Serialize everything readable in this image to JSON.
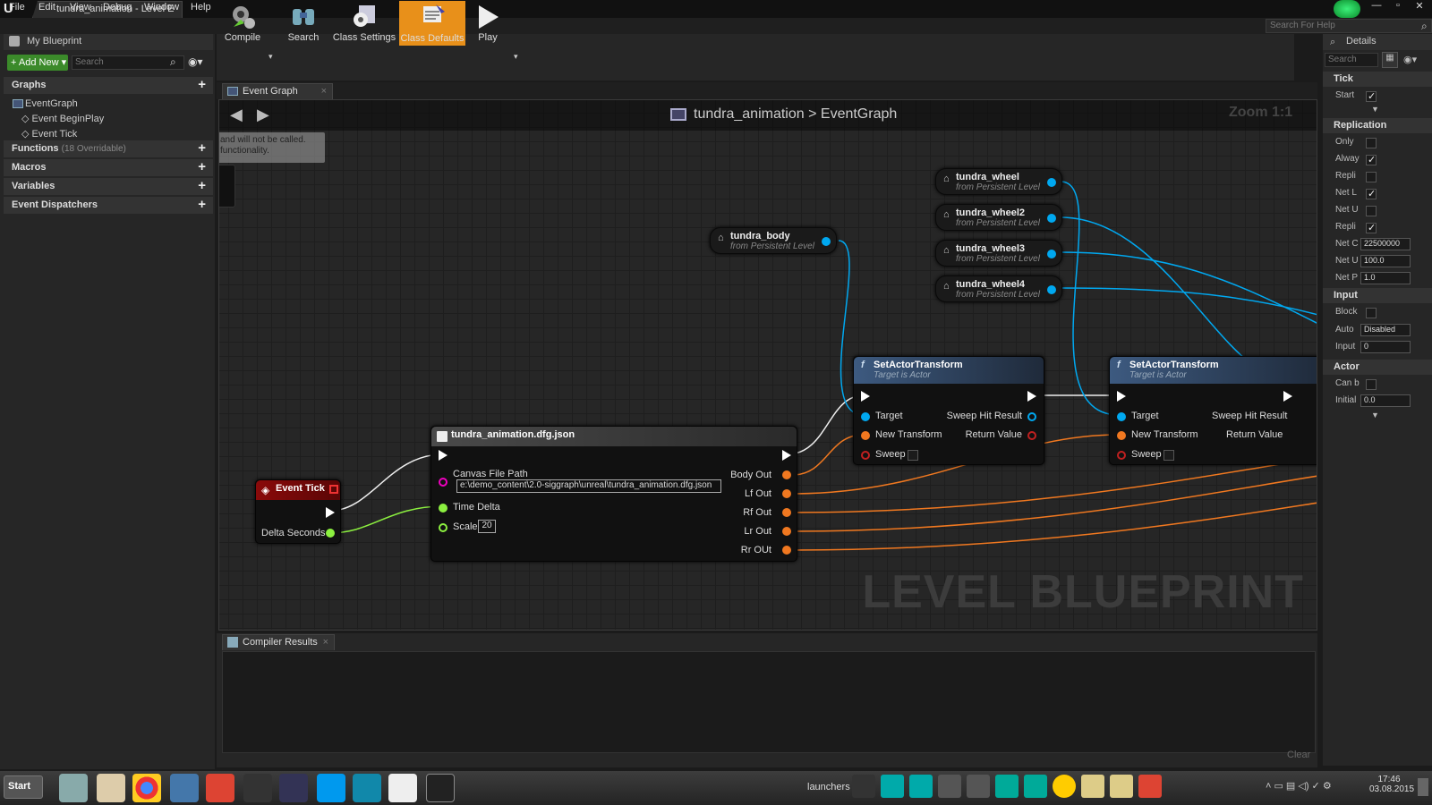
{
  "window": {
    "tab_title": "tundra_animation - Level E",
    "help_search_placeholder": "Search For Help"
  },
  "menu": [
    "File",
    "Edit",
    "View",
    "Debug",
    "Window",
    "Help"
  ],
  "my_blueprint": {
    "title": "My Blueprint",
    "add_new": "Add New",
    "search_placeholder": "Search",
    "graphs_label": "Graphs",
    "graph_items": [
      "EventGraph",
      "Event BeginPlay",
      "Event Tick"
    ],
    "functions_label": "Functions",
    "functions_note": "(18 Overridable)",
    "macros_label": "Macros",
    "variables_label": "Variables",
    "dispatchers_label": "Event Dispatchers"
  },
  "toolbar": {
    "compile": "Compile",
    "search": "Search",
    "class_settings": "Class Settings",
    "class_defaults": "Class Defaults",
    "play": "Play"
  },
  "graph_tab": "Event Graph",
  "breadcrumb": {
    "blueprint": "tundra_animation",
    "separator": ">",
    "graph": "EventGraph"
  },
  "zoom": "Zoom 1:1",
  "comment_lines": [
    "and will not be called.",
    "functionality."
  ],
  "nodes": {
    "event_tick": {
      "title": "Event Tick",
      "pin": "Delta Seconds"
    },
    "dfg": {
      "title": "tundra_animation.dfg.json",
      "in_pins": [
        "Canvas File Path",
        "Time Delta",
        "Scale"
      ],
      "path_value": "e:\\demo_content\\2.0-siggraph\\unreal\\tundra_animation.dfg.json",
      "scale_value": "20",
      "out_pins": [
        "Body Out",
        "Lf Out",
        "Rf Out",
        "Lr Out",
        "Rr OUt"
      ]
    },
    "getters": [
      {
        "name": "tundra_body",
        "sub": "from Persistent Level"
      },
      {
        "name": "tundra_wheel",
        "sub": "from Persistent Level"
      },
      {
        "name": "tundra_wheel2",
        "sub": "from Persistent Level"
      },
      {
        "name": "tundra_wheel3",
        "sub": "from Persistent Level"
      },
      {
        "name": "tundra_wheel4",
        "sub": "from Persistent Level"
      }
    ],
    "set_actor_1": {
      "title": "SetActorTransform",
      "subtitle": "Target is Actor",
      "target": "Target",
      "new_transform": "New Transform",
      "sweep": "Sweep",
      "sweep_hit": "Sweep Hit Result",
      "return_value": "Return Value"
    },
    "set_actor_2": {
      "title": "SetActorTransform",
      "subtitle": "Target is Actor",
      "target": "Target",
      "new_transform": "New Transform",
      "sweep": "Sweep",
      "sweep_hit": "Sweep Hit Result",
      "return_value": "Return Value"
    }
  },
  "watermark": "LEVEL BLUEPRINT",
  "compiler": {
    "tab": "Compiler Results",
    "clear": "Clear"
  },
  "details": {
    "title": "Details",
    "search_placeholder": "Search",
    "tick": {
      "label": "Tick",
      "rows": [
        {
          "label": "Start",
          "checked": true
        }
      ]
    },
    "replication": {
      "label": "Replication",
      "rows": [
        {
          "label": "Only",
          "checked": false
        },
        {
          "label": "Alway",
          "checked": true
        },
        {
          "label": "Repli",
          "checked": false
        },
        {
          "label": "Net L",
          "checked": true
        },
        {
          "label": "Net U",
          "checked": false
        },
        {
          "label": "Repli",
          "checked": true
        }
      ],
      "inputs": [
        {
          "label": "Net C",
          "value": "22500000"
        },
        {
          "label": "Net U",
          "value": "100.0"
        },
        {
          "label": "Net P",
          "value": "1.0"
        }
      ]
    },
    "input": {
      "label": "Input",
      "block": "Block",
      "auto": "Auto",
      "auto_value": "Disabled",
      "input": "Input",
      "input_value": "0"
    },
    "actor": {
      "label": "Actor",
      "can": "Can b",
      "initial": "Initial",
      "initial_value": "0.0"
    }
  },
  "taskbar": {
    "start": "Start",
    "launchers": "launchers",
    "time": "17:46",
    "date": "03.08.2015"
  },
  "colors": {
    "exec": "#ffffff",
    "object_pin": "#00a8f0",
    "struct_pin": "#f07820",
    "float_pin": "#8cf040",
    "string_pin": "#f000c0",
    "event_head": "#8a0a0a",
    "function_head": "#3d5a80",
    "accent": "#f0a020"
  }
}
